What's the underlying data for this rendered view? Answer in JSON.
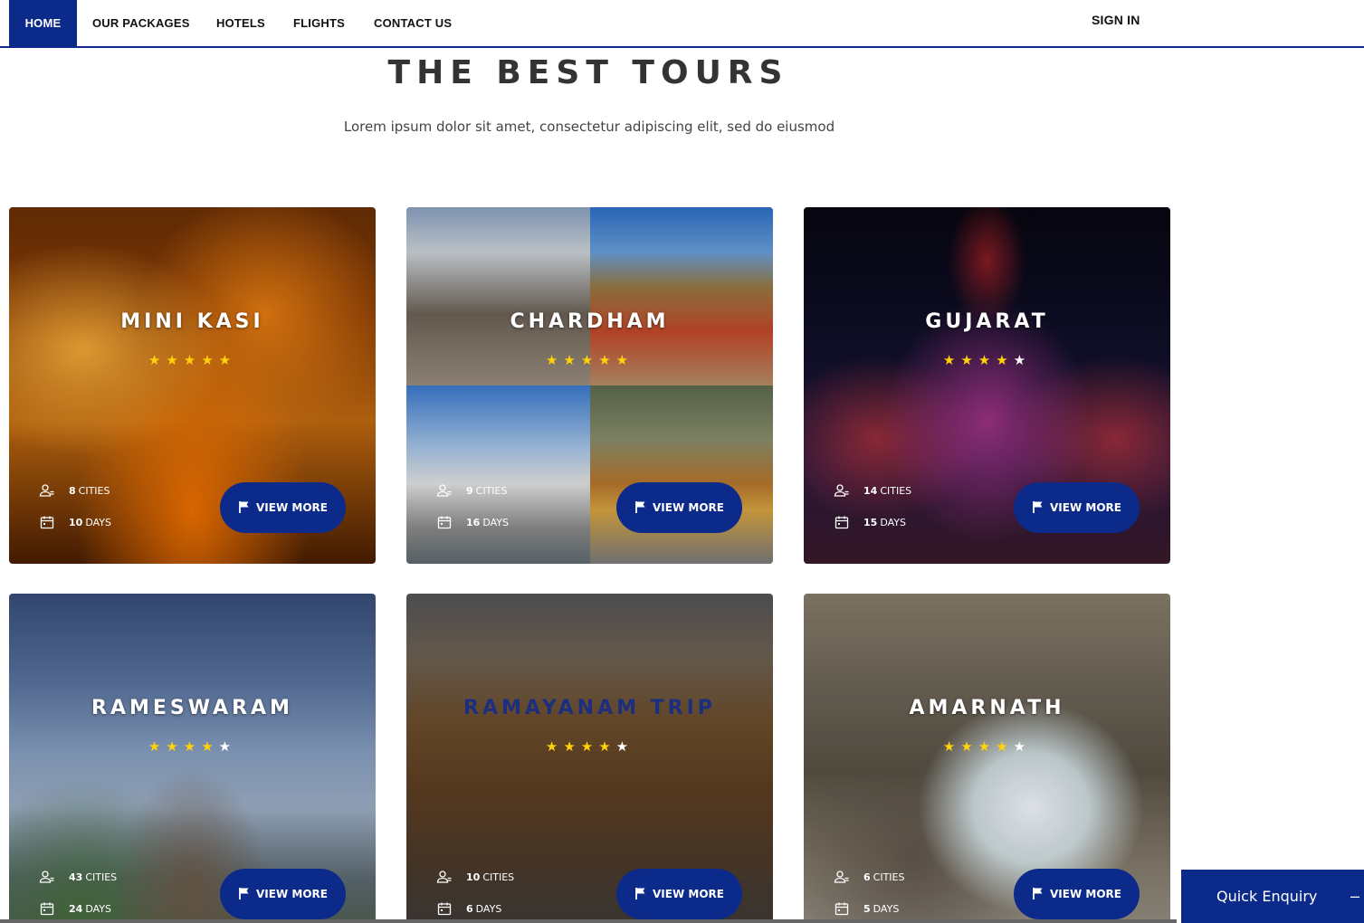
{
  "nav": {
    "items": [
      {
        "label": "HOME",
        "active": true
      },
      {
        "label": "OUR PACKAGES"
      },
      {
        "label": "HOTELS"
      },
      {
        "label": "FLIGHTS"
      },
      {
        "label": "CONTACT US"
      }
    ],
    "sign_in": "SIGN IN"
  },
  "header": {
    "title": "THE BEST TOURS",
    "subtitle": "Lorem ipsum dolor sit amet, consectetur adipiscing elit, sed do eiusmod"
  },
  "tours": [
    {
      "name": "MINI KASI",
      "rating": 5,
      "cities": "8",
      "cities_label": "CITIES",
      "days": "10",
      "days_label": "DAYS",
      "button": "VIEW MORE"
    },
    {
      "name": "CHARDHAM",
      "rating": 5,
      "cities": "9",
      "cities_label": "CITIES",
      "days": "16",
      "days_label": "DAYS",
      "button": "VIEW MORE"
    },
    {
      "name": "GUJARAT",
      "rating": 4,
      "cities": "14",
      "cities_label": "CITIES",
      "days": "15",
      "days_label": "DAYS",
      "button": "VIEW MORE"
    },
    {
      "name": "RAMESWARAM",
      "rating": 4,
      "cities": "43",
      "cities_label": "CITIES",
      "days": "24",
      "days_label": "DAYS",
      "button": "VIEW MORE"
    },
    {
      "name": "RAMAYANAM TRIP",
      "rating": 4,
      "cities": "10",
      "cities_label": "CITIES",
      "days": "6",
      "days_label": "DAYS",
      "button": "VIEW MORE"
    },
    {
      "name": "AMARNATH",
      "rating": 4,
      "cities": "6",
      "cities_label": "CITIES",
      "days": "5",
      "days_label": "DAYS",
      "button": "VIEW MORE"
    }
  ],
  "star_max": 5,
  "enquiry": {
    "label": "Quick Enquiry",
    "toggle": "–"
  },
  "colors": {
    "brand": "#0b2a8a",
    "star_on": "#ffd20a",
    "star_off": "#ffffff"
  },
  "icons": {
    "cities": "users-icon",
    "days": "calendar-icon",
    "view_more": "flag-icon"
  }
}
